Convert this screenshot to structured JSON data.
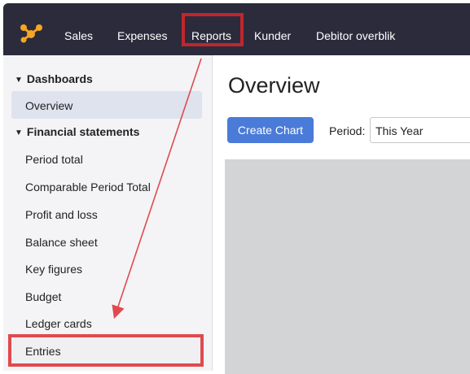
{
  "topbar": {
    "nav": [
      "Sales",
      "Expenses",
      "Reports",
      "Kunder",
      "Debitor overblik"
    ],
    "highlighted": "Reports"
  },
  "sidebar": {
    "sections": [
      {
        "label": "Dashboards",
        "items": [
          "Overview"
        ]
      },
      {
        "label": "Financial statements",
        "items": [
          "Period total",
          "Comparable Period Total",
          "Profit and loss",
          "Balance sheet",
          "Key figures",
          "Budget",
          "Ledger cards",
          "Entries"
        ]
      }
    ],
    "active_item": "Overview",
    "highlighted_item": "Entries"
  },
  "main": {
    "title": "Overview",
    "create_button": "Create Chart",
    "period_label": "Period:",
    "period_value": "This Year"
  },
  "colors": {
    "topbar": "#2c2b3c",
    "accent_blue": "#4a7bd8",
    "highlight_red": "#e04a4f",
    "overlay_gray": "#d3d4d5"
  }
}
